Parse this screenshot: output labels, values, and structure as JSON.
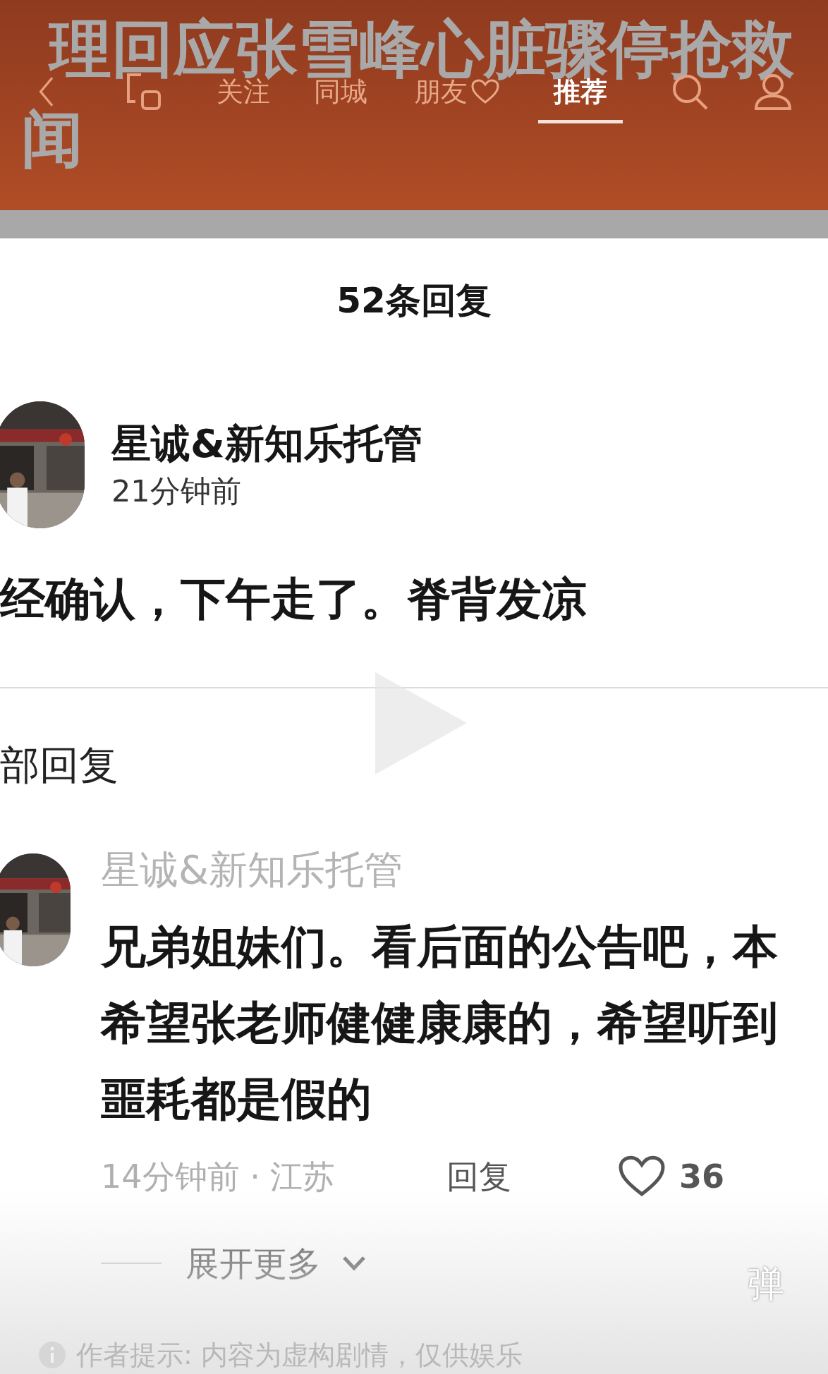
{
  "video_title": {
    "lines": [
      "理回应张雪峰心脏骤停抢救",
      "闻"
    ]
  },
  "nav": {
    "tabs": [
      {
        "label": "关注",
        "selected": false,
        "heart": false
      },
      {
        "label": "同城",
        "selected": false,
        "heart": false
      },
      {
        "label": "朋友",
        "selected": false,
        "heart": true
      },
      {
        "label": "推荐",
        "selected": true,
        "heart": false
      }
    ]
  },
  "reply_panel": {
    "title": "52条回复",
    "main_comment": {
      "author": "星诚&新知乐托管",
      "time": "21分钟前",
      "text": "经确认，下午走了。脊背发凉"
    },
    "section_label": "部回复",
    "replies": [
      {
        "author": "星诚&新知乐托管",
        "lines": [
          "兄弟姐妹们。看后面的公告吧，本",
          "希望张老师健健康康的，希望听到",
          "噩耗都是假的"
        ],
        "meta": "14分钟前 · 江苏",
        "reply_label": "回复",
        "likes": "36",
        "liked": false
      }
    ],
    "expand_label": "展开更多"
  },
  "danmaku_button": "弹",
  "author_notice": "作者提示: 内容为虚构剧情，仅供娱乐"
}
